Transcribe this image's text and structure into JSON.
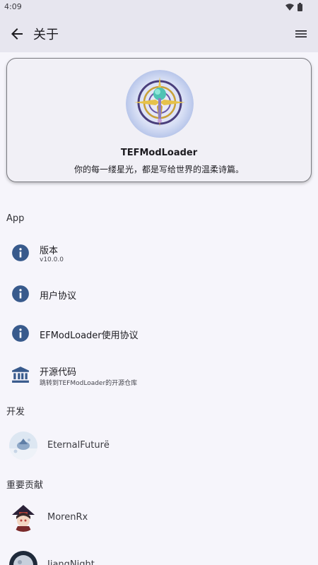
{
  "status_bar": {
    "time": "4:09"
  },
  "app_bar": {
    "title": "关于"
  },
  "about_card": {
    "app_name": "TEFModLoader",
    "tagline": "你的每一缕星光，都是写给世界的温柔诗篇。"
  },
  "sections": {
    "app": "App",
    "developer": "开发",
    "contributors": "重要贡献"
  },
  "app_items": [
    {
      "title": "版本",
      "summary": "v10.0.0",
      "icon": "info-icon"
    },
    {
      "title": "用户协议",
      "summary": "",
      "icon": "info-icon"
    },
    {
      "title": "EFModLoader使用协议",
      "summary": "",
      "icon": "info-icon"
    },
    {
      "title": "开源代码",
      "summary": "跳转到TEFModLoader的开源仓库",
      "icon": "bank-icon"
    }
  ],
  "developer": {
    "name": "EternalFuturё"
  },
  "contributors": [
    {
      "name": "MorenRx"
    },
    {
      "name": "JiangNight"
    }
  ],
  "colors": {
    "app_bar_bg": "#e7e6ef",
    "icon_blue": "#385a8c",
    "page_bg": "#f6f5fb"
  }
}
